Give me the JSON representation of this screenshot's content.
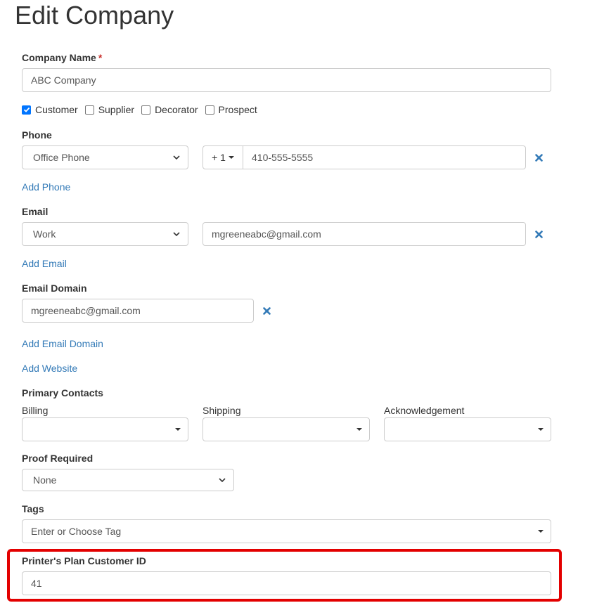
{
  "page": {
    "title": "Edit Company"
  },
  "company_name": {
    "label": "Company Name",
    "required_mark": "*",
    "value": "ABC Company"
  },
  "types": [
    {
      "label": "Customer",
      "checked": true
    },
    {
      "label": "Supplier",
      "checked": false
    },
    {
      "label": "Decorator",
      "checked": false
    },
    {
      "label": "Prospect",
      "checked": false
    }
  ],
  "phone": {
    "label": "Phone",
    "type_value": "Office Phone",
    "country_code": "+ 1",
    "number": "410-555-5555",
    "add_link": "Add Phone"
  },
  "email": {
    "label": "Email",
    "type_value": "Work",
    "address": "mgreeneabc@gmail.com",
    "add_link": "Add Email"
  },
  "email_domain": {
    "label": "Email Domain",
    "value": "mgreeneabc@gmail.com",
    "add_link": "Add Email Domain"
  },
  "website": {
    "add_link": "Add Website"
  },
  "primary_contacts": {
    "label": "Primary Contacts",
    "billing_label": "Billing",
    "shipping_label": "Shipping",
    "acknowledgement_label": "Acknowledgement"
  },
  "proof_required": {
    "label": "Proof Required",
    "value": "None"
  },
  "tags": {
    "label": "Tags",
    "placeholder": "Enter or Choose Tag"
  },
  "printers_plan": {
    "label": "Printer's Plan Customer ID",
    "value": "41"
  },
  "colors": {
    "link": "#337ab7",
    "highlight": "#e30000",
    "checkbox": "#0075ff"
  }
}
